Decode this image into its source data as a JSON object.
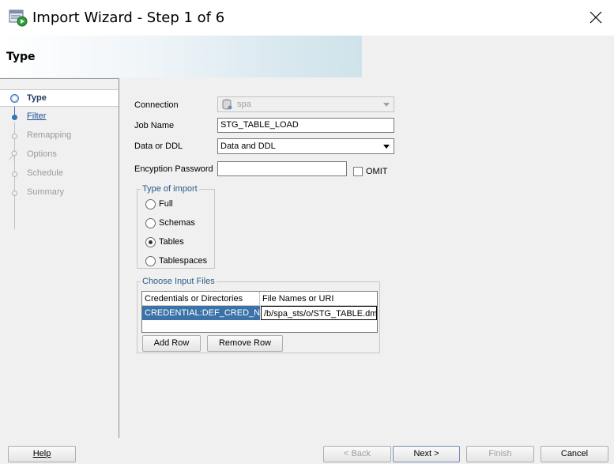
{
  "window": {
    "title": "Import Wizard - Step 1 of 6",
    "app_icon": "import-wizard-icon",
    "close_icon": "close-icon"
  },
  "header": {
    "title": "Type"
  },
  "steps": [
    {
      "label": "Type",
      "state": "current"
    },
    {
      "label": "Filter",
      "state": "link"
    },
    {
      "label": "Remapping",
      "state": "disabled"
    },
    {
      "label": "Options",
      "state": "disabled"
    },
    {
      "label": "Schedule",
      "state": "disabled"
    },
    {
      "label": "Summary",
      "state": "disabled"
    }
  ],
  "form": {
    "connection": {
      "label": "Connection",
      "value": "spa",
      "icon": "database-icon"
    },
    "job_name": {
      "label": "Job Name",
      "value": "STG_TABLE_LOAD"
    },
    "data_or_ddl": {
      "label": "Data or DDL",
      "value": "Data and DDL"
    },
    "encryption": {
      "label": "Encyption Password",
      "value": "",
      "omit_label": "OMIT",
      "omit_checked": false
    }
  },
  "type_of_import": {
    "title": "Type of import",
    "options": [
      {
        "label": "Full",
        "checked": false
      },
      {
        "label": "Schemas",
        "checked": false
      },
      {
        "label": "Tables",
        "checked": true
      },
      {
        "label": "Tablespaces",
        "checked": false
      }
    ]
  },
  "input_files": {
    "title": "Choose Input Files",
    "columns": [
      "Credentials or Directories",
      "File Names or URI"
    ],
    "rows": [
      [
        "CREDENTIAL:DEF_CRED_N...",
        "/b/spa_sts/o/STG_TABLE.dmp"
      ]
    ],
    "add_row": "Add Row",
    "remove_row": "Remove Row"
  },
  "footer": {
    "help": "Help",
    "back": "< Back",
    "next": "Next >",
    "finish": "Finish",
    "cancel": "Cancel"
  },
  "colors": {
    "selection": "#3b72a8",
    "group_title": "#2a5a8c",
    "step_active": "#3b73b9"
  }
}
